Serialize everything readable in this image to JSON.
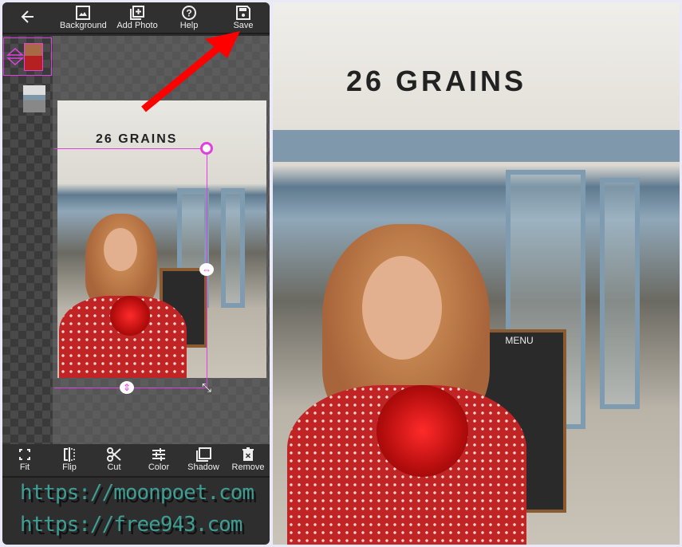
{
  "toolbar": {
    "back_icon": "arrow-left-icon",
    "items": [
      {
        "label": "Background",
        "icon": "image-icon"
      },
      {
        "label": "Add Photo",
        "icon": "add-photo-icon"
      },
      {
        "label": "Help",
        "icon": "help-circle-icon"
      },
      {
        "label": "Save",
        "icon": "floppy-disk-icon"
      }
    ]
  },
  "bottom_toolbar": {
    "items": [
      {
        "label": "Fit",
        "icon": "fit-icon"
      },
      {
        "label": "Flip",
        "icon": "flip-icon"
      },
      {
        "label": "Cut",
        "icon": "scissors-icon"
      },
      {
        "label": "Color",
        "icon": "sliders-icon"
      },
      {
        "label": "Shadow",
        "icon": "shadow-icon"
      },
      {
        "label": "Remove",
        "icon": "trash-icon"
      }
    ]
  },
  "watermark": {
    "line1": "https://moonpoet.com",
    "line2": "https://free943.com"
  },
  "photo": {
    "sign_text": "26 GRAINS",
    "board_title": "MENU"
  },
  "colors": {
    "selection": "#e040e0",
    "arrow": "#ff0000",
    "watermark": "#3e9e94"
  }
}
